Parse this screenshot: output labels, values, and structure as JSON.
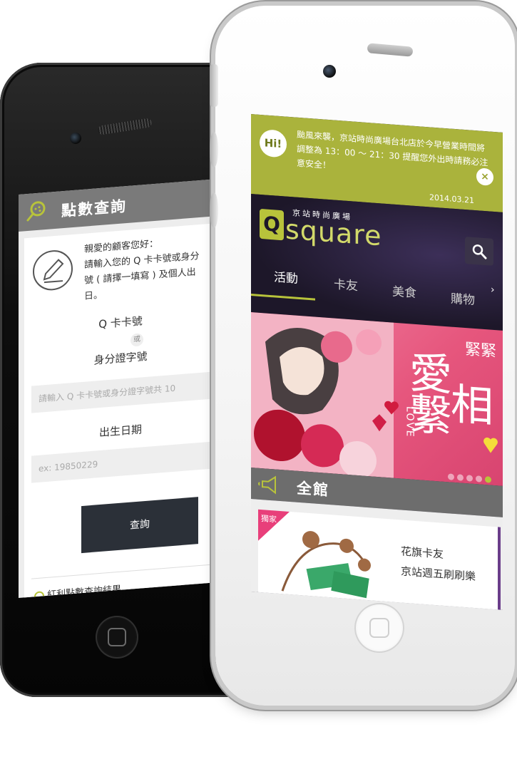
{
  "back_phone": {
    "header_title": "點數查詢",
    "intro_text": "親愛的顧客您好：\n請輸入您的 Q 卡卡號或身分\n號 ( 請擇一填寫 ) 及個人出\n日。",
    "label_card": "Q 卡卡號",
    "label_or": "或",
    "label_id": "身分證字號",
    "id_input_placeholder": "請輸入 Q 卡卡號或身分證字號共 10",
    "label_birthdate": "出生日期",
    "birthdate_placeholder": "ex: 19850229",
    "query_button": "查詢",
    "result_heading": "紅利點數查詢結果"
  },
  "front_phone": {
    "notice": {
      "badge": "Hi!",
      "text": "颱風來襲，京站時尚廣場台北店於今早營業時間將調整為 13：00 ～ 21：30 提醒您外出時請務必注意安全！",
      "date": "2014.03.21",
      "close": "×"
    },
    "brand": {
      "logo_letter": "Q",
      "subtitle": "京站時尚廣場",
      "wordmark": "square"
    },
    "tabs": [
      {
        "label": "活動"
      },
      {
        "label": "卡友"
      },
      {
        "label": "美食"
      },
      {
        "label": "購物"
      }
    ],
    "banner": {
      "small_text": "緊緊",
      "title_col1": "愛 繫",
      "title_col2": "相",
      "love": "LOVE"
    },
    "section_title": "全館",
    "list_item": {
      "badge": "獨家",
      "title": "花旗卡友\n京站週五刷刷樂"
    },
    "colors": {
      "accent_green": "#b8c33b",
      "banner_pink": "#e6567d",
      "dark_purple": "#1d1729"
    }
  }
}
